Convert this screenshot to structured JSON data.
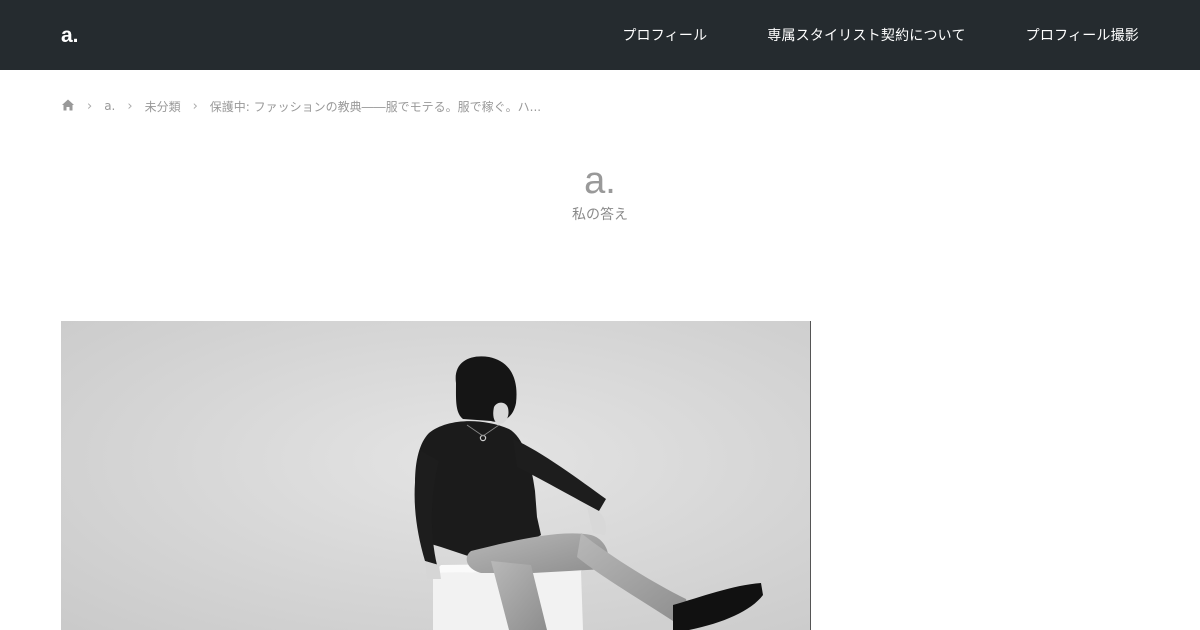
{
  "header": {
    "logo": "a.",
    "nav": [
      {
        "label": "プロフィール"
      },
      {
        "label": "専属スタイリスト契約について"
      },
      {
        "label": "プロフィール撮影"
      }
    ],
    "background": "#252b2f"
  },
  "breadcrumb": {
    "home_icon": "home-icon",
    "items": [
      {
        "label": "a."
      },
      {
        "label": "未分類"
      },
      {
        "label": "保護中: ファッションの教典――服でモテる。服で稼ぐ。ハ..."
      }
    ]
  },
  "site": {
    "title": "a.",
    "description": "私の答え"
  },
  "featured_image": {
    "description": "monochrome"
  }
}
